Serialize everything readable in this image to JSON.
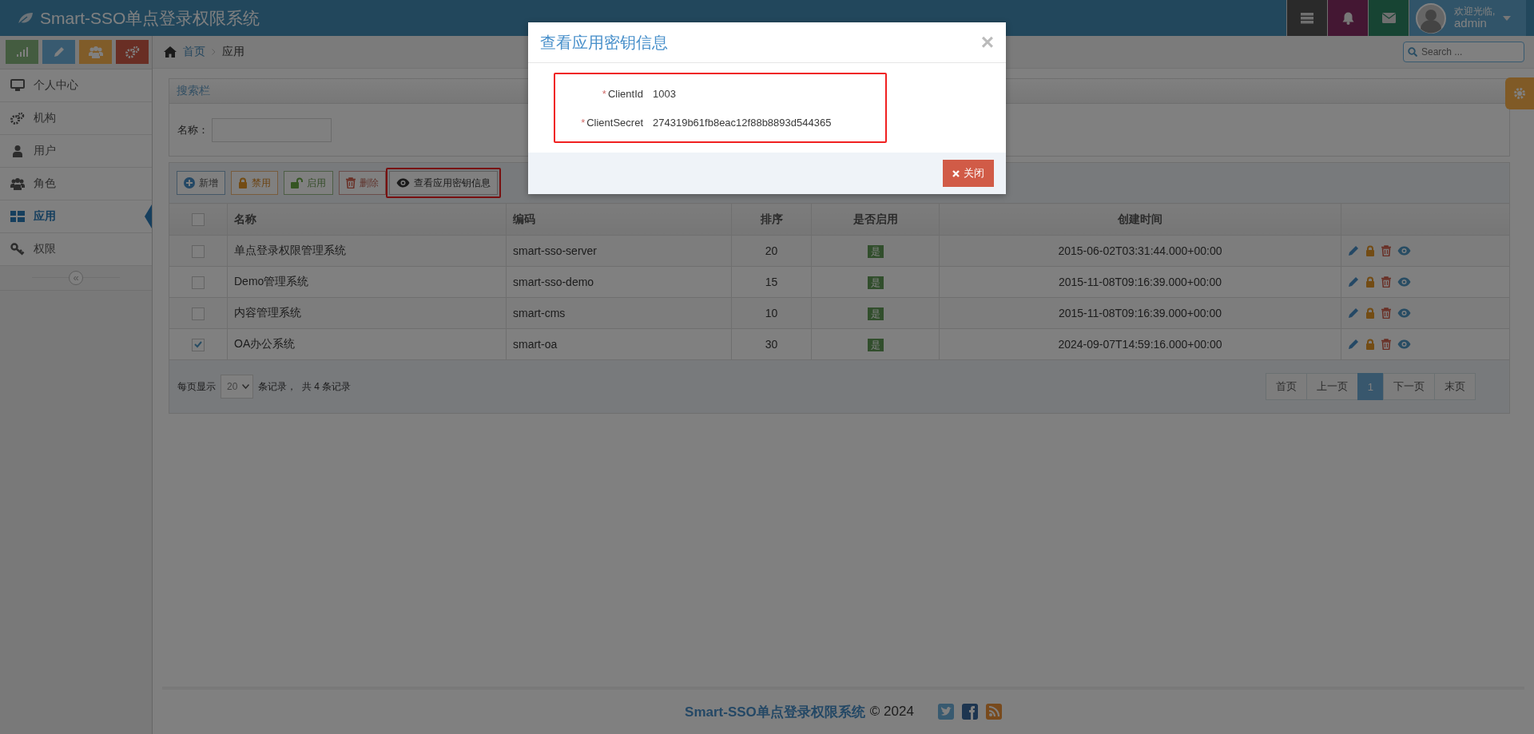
{
  "app": {
    "title": "Smart-SSO单点登录权限系统"
  },
  "user": {
    "greeting": "欢迎光临,",
    "name": "admin"
  },
  "search": {
    "placeholder": "Search ..."
  },
  "sidebar": {
    "items": [
      {
        "label": "个人中心",
        "kind": "monitor",
        "selected": false
      },
      {
        "label": "机构",
        "kind": "gears",
        "selected": false
      },
      {
        "label": "用户",
        "kind": "user",
        "selected": false
      },
      {
        "label": "角色",
        "kind": "users",
        "selected": false
      },
      {
        "label": "应用",
        "kind": "grid",
        "selected": true
      },
      {
        "label": "权限",
        "kind": "key",
        "selected": false
      }
    ],
    "collapse": "«"
  },
  "breadcrumb": [
    "首页",
    "应用"
  ],
  "search_panel": {
    "title": "搜索栏",
    "field_label": "名称："
  },
  "toolbar": [
    {
      "label": "新增",
      "kind": "add",
      "highlighted": false
    },
    {
      "label": "禁用",
      "kind": "disable",
      "highlighted": false
    },
    {
      "label": "启用",
      "kind": "enable",
      "highlighted": false
    },
    {
      "label": "删除",
      "kind": "delete",
      "highlighted": false
    },
    {
      "label": "查看应用密钥信息",
      "kind": "view",
      "highlighted": true
    }
  ],
  "table": {
    "select_all": false,
    "columns": [
      "名称",
      "编码",
      "排序",
      "是否启用",
      "创建时间"
    ],
    "rows": [
      {
        "selected": false,
        "name": "单点登录权限管理系统",
        "code": "smart-sso-server",
        "sort": "20",
        "enabled": "是",
        "created": "2015-06-02T03:31:44.000+00:00"
      },
      {
        "selected": false,
        "name": "Demo管理系统",
        "code": "smart-sso-demo",
        "sort": "15",
        "enabled": "是",
        "created": "2015-11-08T09:16:39.000+00:00"
      },
      {
        "selected": false,
        "name": "内容管理系统",
        "code": "smart-cms",
        "sort": "10",
        "enabled": "是",
        "created": "2015-11-08T09:16:39.000+00:00"
      },
      {
        "selected": true,
        "name": "OA办公系统",
        "code": "smart-oa",
        "sort": "30",
        "enabled": "是",
        "created": "2024-09-07T14:59:16.000+00:00"
      }
    ]
  },
  "pager": {
    "prefix": "每页显示",
    "page_size": "20",
    "suffix": "条记录，  共 4 条记录",
    "pages": [
      {
        "label": "首页",
        "selected": false
      },
      {
        "label": "上一页",
        "selected": false
      },
      {
        "label": "1",
        "selected": true
      },
      {
        "label": "下一页",
        "selected": false
      },
      {
        "label": "末页",
        "selected": false
      }
    ]
  },
  "footer": {
    "brand": "Smart-SSO单点登录权限系统",
    "copyright": "© 2024"
  },
  "modal": {
    "title": "查看应用密钥信息",
    "close": "×",
    "fields": [
      {
        "mark": "*",
        "label": "ClientId",
        "value": "1003"
      },
      {
        "mark": "*",
        "label": "ClientSecret",
        "value": "274319b61fb8eac12f88b8893d544365"
      }
    ],
    "button": "关闭"
  }
}
